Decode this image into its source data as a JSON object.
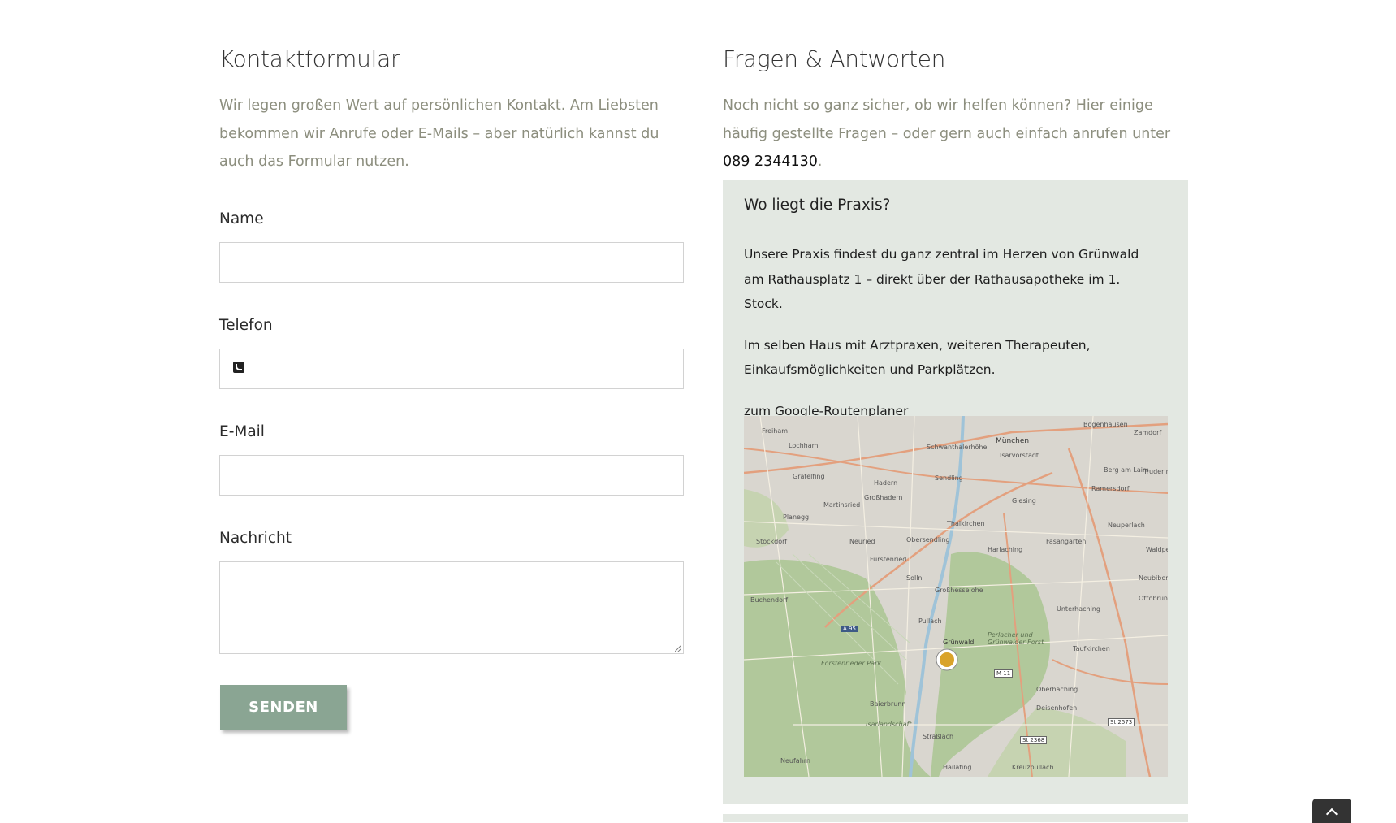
{
  "contact": {
    "title": "Kontaktformular",
    "intro": "Wir legen großen Wert auf persönlichen Kontakt. Am Liebsten bekommen wir Anrufe oder E-Mails – aber natürlich kannst du auch das Formular nutzen.",
    "fields": {
      "name_label": "Name",
      "phone_label": "Telefon",
      "email_label": "E-Mail",
      "message_label": "Nachricht"
    },
    "submit_label": "SENDEN"
  },
  "faq": {
    "title": "Fragen & Antworten",
    "intro_before": "Noch nicht so ganz sicher, ob wir helfen können? Hier einige häufig gestellte Fragen – oder gern auch einfach anrufen unter ",
    "phone": "089 2344130",
    "intro_after": ".",
    "item": {
      "toggle": "–",
      "question": "Wo liegt die Praxis?",
      "answer_1": "Unsere Praxis findest du ganz zentral im Herzen von Grünwald am Rathausplatz 1 – direkt über der Rathausapotheke im 1. Stock.",
      "answer_2": "Im selben Haus mit Arztpraxen, weiteren Therapeuten, Einkaufsmöglichkeiten und Parkplätzen.",
      "link": "zum Google-Routenplaner"
    }
  },
  "map": {
    "place_labels": [
      "Freiham",
      "Lochham",
      "Gräfelfing",
      "Planegg",
      "Stockdorf",
      "Martinsried",
      "Großhadern",
      "Hadern",
      "Neuried",
      "Fürstenried",
      "Obersendling",
      "Sendling",
      "Thalkirchen",
      "Harlaching",
      "Giesing",
      "München",
      "Bogenhausen",
      "Zamdorf",
      "Berg am Laim",
      "Trudering",
      "Ramersdorf",
      "Neuperlach",
      "Fasangarten",
      "Waldperlach",
      "Neubiberg",
      "Unterhaching",
      "Ottobrunn",
      "Taufkirchen",
      "Oberhaching",
      "Grünwald",
      "Pullach",
      "Großhesselohe",
      "Solln",
      "Buchendorf",
      "Forstenrieder Park",
      "Perlacher und Grünwalder Forst",
      "Isarlandschaft",
      "Straßlach",
      "Baierbrunn",
      "Hailafing",
      "Neufahrn",
      "Kreuzpullach",
      "Deisenhofen",
      "Schwanthalerhöhe",
      "Isarvorstadt"
    ],
    "road_labels": [
      "A 95",
      "M 11",
      "St 2573",
      "St 2368"
    ],
    "colors": {
      "forest": "#b1c89b",
      "urban": "#d9d6cf",
      "road_major": "#e3a07e",
      "road_minor": "#f4efe2",
      "marker": "#d9a32a"
    }
  },
  "colors": {
    "muted_text": "#8c8e7e",
    "button": "#8aa593",
    "panel": "#e3e8e2"
  },
  "icons": {
    "phone_field": "phone-icon",
    "scroll_top": "chevron-up-icon"
  }
}
